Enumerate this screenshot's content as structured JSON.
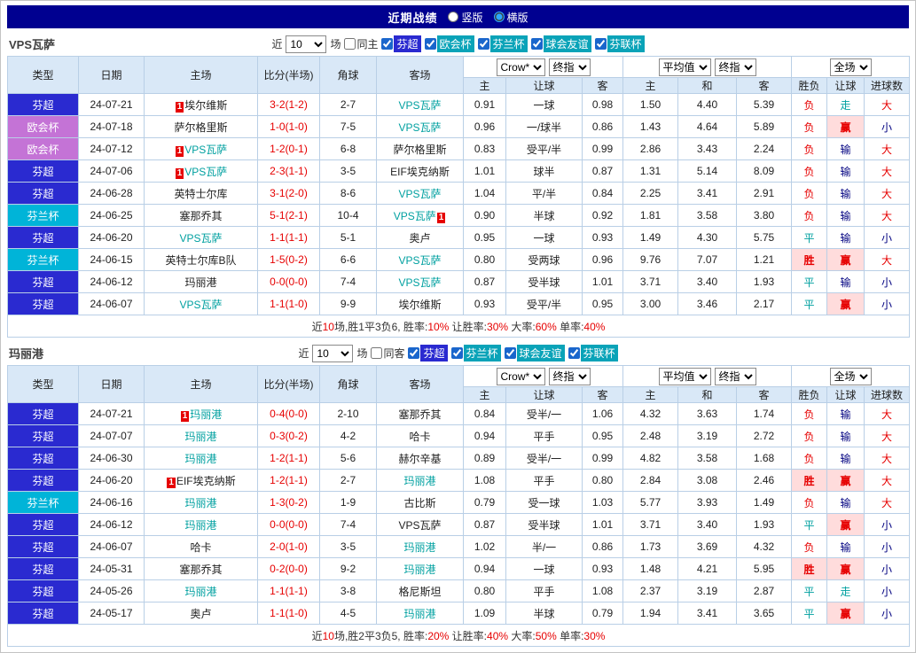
{
  "page": {
    "title": "近期战绩",
    "view_options": [
      {
        "label": "竖版",
        "selected": false
      },
      {
        "label": "横版",
        "selected": true
      }
    ]
  },
  "filter": {
    "near_label": "近",
    "near_value": "10",
    "games_label": "场"
  },
  "table_headers": {
    "col_type": "类型",
    "col_date": "日期",
    "col_home": "主场",
    "col_score": "比分(半场)",
    "col_corner": "角球",
    "col_away": "客场",
    "odds_select_1": "Crow*",
    "odds_select_2": "终指",
    "avg_select_1": "平均值",
    "avg_select_2": "终指",
    "full_select": "全场",
    "sub_home": "主",
    "sub_handicap": "让球",
    "sub_away": "客",
    "sub_home2": "主",
    "sub_draw": "和",
    "sub_away2": "客",
    "sub_result": "胜负",
    "sub_handicap2": "让球",
    "sub_goals": "进球数"
  },
  "colors": {
    "type_bg": {
      "芬超": "#2a2ad0",
      "欧会杯": "#c473d6",
      "芬兰杯": "#00b4d8"
    },
    "score": "#e60000",
    "self_team": "#00a0a0",
    "badge_bg": "#e60000",
    "result": {
      "胜": {
        "color": "#e60000",
        "bg": "#ffdcdc",
        "bold": true
      },
      "平": {
        "color": "#00a0a0"
      },
      "负": {
        "color": "#e60000"
      }
    },
    "handicap_result": {
      "赢": {
        "color": "#e60000",
        "bg": "#ffdcdc",
        "bold": true
      },
      "走": {
        "color": "#00a0a0"
      },
      "输": {
        "color": "#000080"
      }
    },
    "goals": {
      "大": {
        "color": "#e60000"
      },
      "小": {
        "color": "#000080"
      }
    }
  },
  "sections": [
    {
      "team": "VPS瓦萨",
      "same_label": "同主",
      "same_checked": false,
      "leagues": [
        {
          "label": "芬超",
          "checked": true,
          "color": "#2a2ad0"
        },
        {
          "label": "欧会杯",
          "checked": true,
          "color": "#0aa3b8"
        },
        {
          "label": "芬兰杯",
          "checked": true,
          "color": "#0aa3b8"
        },
        {
          "label": "球会友谊",
          "checked": true,
          "color": "#0aa3b8"
        },
        {
          "label": "芬联杯",
          "checked": true,
          "color": "#0aa3b8"
        }
      ],
      "rows": [
        {
          "type": "芬超",
          "date": "24-07-21",
          "home": "埃尔维斯",
          "home_badge": "1",
          "home_self": false,
          "score": "3-2(1-2)",
          "corner": "2-7",
          "away": "VPS瓦萨",
          "away_self": true,
          "o1": "0.91",
          "hcp": "一球",
          "o2": "0.98",
          "a1": "1.50",
          "a2": "4.40",
          "a3": "5.39",
          "res": "负",
          "hres": "走",
          "big": "大"
        },
        {
          "type": "欧会杯",
          "date": "24-07-18",
          "home": "萨尔格里斯",
          "home_self": false,
          "score": "1-0(1-0)",
          "corner": "7-5",
          "away": "VPS瓦萨",
          "away_self": true,
          "o1": "0.96",
          "hcp": "一/球半",
          "o2": "0.86",
          "a1": "1.43",
          "a2": "4.64",
          "a3": "5.89",
          "res": "负",
          "hres": "赢",
          "big": "小"
        },
        {
          "type": "欧会杯",
          "date": "24-07-12",
          "home": "VPS瓦萨",
          "home_badge": "1",
          "home_self": true,
          "score": "1-2(0-1)",
          "corner": "6-8",
          "away": "萨尔格里斯",
          "away_self": false,
          "o1": "0.83",
          "hcp": "受平/半",
          "o2": "0.99",
          "a1": "2.86",
          "a2": "3.43",
          "a3": "2.24",
          "res": "负",
          "hres": "输",
          "big": "大"
        },
        {
          "type": "芬超",
          "date": "24-07-06",
          "home": "VPS瓦萨",
          "home_badge": "1",
          "home_self": true,
          "score": "2-3(1-1)",
          "corner": "3-5",
          "away": "EIF埃克纳斯",
          "away_self": false,
          "o1": "1.01",
          "hcp": "球半",
          "o2": "0.87",
          "a1": "1.31",
          "a2": "5.14",
          "a3": "8.09",
          "res": "负",
          "hres": "输",
          "big": "大"
        },
        {
          "type": "芬超",
          "date": "24-06-28",
          "home": "英特士尔库",
          "home_self": false,
          "score": "3-1(2-0)",
          "corner": "8-6",
          "away": "VPS瓦萨",
          "away_self": true,
          "o1": "1.04",
          "hcp": "平/半",
          "o2": "0.84",
          "a1": "2.25",
          "a2": "3.41",
          "a3": "2.91",
          "res": "负",
          "hres": "输",
          "big": "大"
        },
        {
          "type": "芬兰杯",
          "date": "24-06-25",
          "home": "塞那乔其",
          "home_self": false,
          "score": "5-1(2-1)",
          "corner": "10-4",
          "away": "VPS瓦萨",
          "away_badge": "1",
          "away_self": true,
          "o1": "0.90",
          "hcp": "半球",
          "o2": "0.92",
          "a1": "1.81",
          "a2": "3.58",
          "a3": "3.80",
          "res": "负",
          "hres": "输",
          "big": "大"
        },
        {
          "type": "芬超",
          "date": "24-06-20",
          "home": "VPS瓦萨",
          "home_self": true,
          "score": "1-1(1-1)",
          "corner": "5-1",
          "away": "奥卢",
          "away_self": false,
          "o1": "0.95",
          "hcp": "一球",
          "o2": "0.93",
          "a1": "1.49",
          "a2": "4.30",
          "a3": "5.75",
          "res": "平",
          "hres": "输",
          "big": "小"
        },
        {
          "type": "芬兰杯",
          "date": "24-06-15",
          "home": "英特士尔库B队",
          "home_self": false,
          "score": "1-5(0-2)",
          "corner": "6-6",
          "away": "VPS瓦萨",
          "away_self": true,
          "o1": "0.80",
          "hcp": "受两球",
          "o2": "0.96",
          "a1": "9.76",
          "a2": "7.07",
          "a3": "1.21",
          "res": "胜",
          "hres": "赢",
          "big": "大"
        },
        {
          "type": "芬超",
          "date": "24-06-12",
          "home": "玛丽港",
          "home_self": false,
          "score": "0-0(0-0)",
          "corner": "7-4",
          "away": "VPS瓦萨",
          "away_self": true,
          "o1": "0.87",
          "hcp": "受半球",
          "o2": "1.01",
          "a1": "3.71",
          "a2": "3.40",
          "a3": "1.93",
          "res": "平",
          "hres": "输",
          "big": "小"
        },
        {
          "type": "芬超",
          "date": "24-06-07",
          "home": "VPS瓦萨",
          "home_self": true,
          "score": "1-1(1-0)",
          "corner": "9-9",
          "away": "埃尔维斯",
          "away_self": false,
          "o1": "0.93",
          "hcp": "受平/半",
          "o2": "0.95",
          "a1": "3.00",
          "a2": "3.46",
          "a3": "2.17",
          "res": "平",
          "hres": "赢",
          "big": "小"
        }
      ],
      "summary": [
        {
          "text": "近",
          "red": false
        },
        {
          "text": "10",
          "red": true
        },
        {
          "text": "场,胜1平3负6, 胜率:",
          "red": false
        },
        {
          "text": "10%",
          "red": true
        },
        {
          "text": " 让胜率:",
          "red": false
        },
        {
          "text": "30%",
          "red": true
        },
        {
          "text": " 大率:",
          "red": false
        },
        {
          "text": "60%",
          "red": true
        },
        {
          "text": " 单率:",
          "red": false
        },
        {
          "text": "40%",
          "red": true
        }
      ]
    },
    {
      "team": "玛丽港",
      "same_label": "同客",
      "same_checked": false,
      "leagues": [
        {
          "label": "芬超",
          "checked": true,
          "color": "#2a2ad0"
        },
        {
          "label": "芬兰杯",
          "checked": true,
          "color": "#0aa3b8"
        },
        {
          "label": "球会友谊",
          "checked": true,
          "color": "#0aa3b8"
        },
        {
          "label": "芬联杯",
          "checked": true,
          "color": "#0aa3b8"
        }
      ],
      "rows": [
        {
          "type": "芬超",
          "date": "24-07-21",
          "home": "玛丽港",
          "home_badge": "1",
          "home_self": true,
          "score": "0-4(0-0)",
          "corner": "2-10",
          "away": "塞那乔其",
          "away_self": false,
          "o1": "0.84",
          "hcp": "受半/一",
          "o2": "1.06",
          "a1": "4.32",
          "a2": "3.63",
          "a3": "1.74",
          "res": "负",
          "hres": "输",
          "big": "大"
        },
        {
          "type": "芬超",
          "date": "24-07-07",
          "home": "玛丽港",
          "home_self": true,
          "score": "0-3(0-2)",
          "corner": "4-2",
          "away": "哈卡",
          "away_self": false,
          "o1": "0.94",
          "hcp": "平手",
          "o2": "0.95",
          "a1": "2.48",
          "a2": "3.19",
          "a3": "2.72",
          "res": "负",
          "hres": "输",
          "big": "大"
        },
        {
          "type": "芬超",
          "date": "24-06-30",
          "home": "玛丽港",
          "home_self": true,
          "score": "1-2(1-1)",
          "corner": "5-6",
          "away": "赫尔辛基",
          "away_self": false,
          "o1": "0.89",
          "hcp": "受半/一",
          "o2": "0.99",
          "a1": "4.82",
          "a2": "3.58",
          "a3": "1.68",
          "res": "负",
          "hres": "输",
          "big": "大"
        },
        {
          "type": "芬超",
          "date": "24-06-20",
          "home": "EIF埃克纳斯",
          "home_badge": "1",
          "home_self": false,
          "score": "1-2(1-1)",
          "corner": "2-7",
          "away": "玛丽港",
          "away_self": true,
          "o1": "1.08",
          "hcp": "平手",
          "o2": "0.80",
          "a1": "2.84",
          "a2": "3.08",
          "a3": "2.46",
          "res": "胜",
          "hres": "赢",
          "big": "大"
        },
        {
          "type": "芬兰杯",
          "date": "24-06-16",
          "home": "玛丽港",
          "home_self": true,
          "score": "1-3(0-2)",
          "corner": "1-9",
          "away": "古比斯",
          "away_self": false,
          "o1": "0.79",
          "hcp": "受一球",
          "o2": "1.03",
          "a1": "5.77",
          "a2": "3.93",
          "a3": "1.49",
          "res": "负",
          "hres": "输",
          "big": "大"
        },
        {
          "type": "芬超",
          "date": "24-06-12",
          "home": "玛丽港",
          "home_self": true,
          "score": "0-0(0-0)",
          "corner": "7-4",
          "away": "VPS瓦萨",
          "away_self": false,
          "o1": "0.87",
          "hcp": "受半球",
          "o2": "1.01",
          "a1": "3.71",
          "a2": "3.40",
          "a3": "1.93",
          "res": "平",
          "hres": "赢",
          "big": "小"
        },
        {
          "type": "芬超",
          "date": "24-06-07",
          "home": "哈卡",
          "home_self": false,
          "score": "2-0(1-0)",
          "corner": "3-5",
          "away": "玛丽港",
          "away_self": true,
          "o1": "1.02",
          "hcp": "半/一",
          "o2": "0.86",
          "a1": "1.73",
          "a2": "3.69",
          "a3": "4.32",
          "res": "负",
          "hres": "输",
          "big": "小"
        },
        {
          "type": "芬超",
          "date": "24-05-31",
          "home": "塞那乔其",
          "home_self": false,
          "score": "0-2(0-0)",
          "corner": "9-2",
          "away": "玛丽港",
          "away_self": true,
          "o1": "0.94",
          "hcp": "一球",
          "o2": "0.93",
          "a1": "1.48",
          "a2": "4.21",
          "a3": "5.95",
          "res": "胜",
          "hres": "赢",
          "big": "小"
        },
        {
          "type": "芬超",
          "date": "24-05-26",
          "home": "玛丽港",
          "home_self": true,
          "score": "1-1(1-1)",
          "corner": "3-8",
          "away": "格尼斯坦",
          "away_self": false,
          "o1": "0.80",
          "hcp": "平手",
          "o2": "1.08",
          "a1": "2.37",
          "a2": "3.19",
          "a3": "2.87",
          "res": "平",
          "hres": "走",
          "big": "小"
        },
        {
          "type": "芬超",
          "date": "24-05-17",
          "home": "奥卢",
          "home_self": false,
          "score": "1-1(1-0)",
          "corner": "4-5",
          "away": "玛丽港",
          "away_self": true,
          "o1": "1.09",
          "hcp": "半球",
          "o2": "0.79",
          "a1": "1.94",
          "a2": "3.41",
          "a3": "3.65",
          "res": "平",
          "hres": "赢",
          "big": "小"
        }
      ],
      "summary": [
        {
          "text": "近",
          "red": false
        },
        {
          "text": "10",
          "red": true
        },
        {
          "text": "场,胜2平3负5, 胜率:",
          "red": false
        },
        {
          "text": "20%",
          "red": true
        },
        {
          "text": " 让胜率:",
          "red": false
        },
        {
          "text": "40%",
          "red": true
        },
        {
          "text": " 大率:",
          "red": false
        },
        {
          "text": "50%",
          "red": true
        },
        {
          "text": " 单率:",
          "red": false
        },
        {
          "text": "30%",
          "red": true
        }
      ]
    }
  ]
}
